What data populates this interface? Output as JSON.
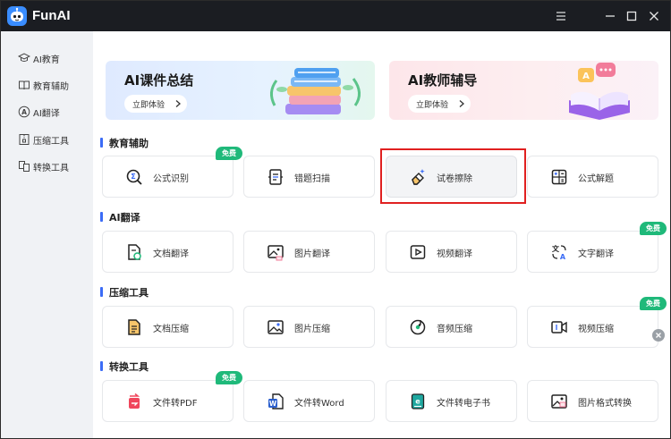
{
  "app": {
    "title": "FunAI"
  },
  "sidebar": {
    "items": [
      {
        "label": "AI教育",
        "icon": "graduation-cap-icon"
      },
      {
        "label": "教育辅助",
        "icon": "open-book-icon"
      },
      {
        "label": "AI翻译",
        "icon": "translate-icon"
      },
      {
        "label": "压缩工具",
        "icon": "archive-icon"
      },
      {
        "label": "转换工具",
        "icon": "convert-icon"
      }
    ]
  },
  "banners": [
    {
      "title": "AI课件总结",
      "button": "立即体验"
    },
    {
      "title": "AI教师辅导",
      "button": "立即体验"
    }
  ],
  "badge_text": "免费",
  "sections": [
    {
      "title": "教育辅助",
      "cards": [
        {
          "label": "公式识别",
          "icon": "formula-search-icon",
          "free": true
        },
        {
          "label": "错题扫描",
          "icon": "scan-document-icon",
          "free": false
        },
        {
          "label": "试卷擦除",
          "icon": "eraser-icon",
          "free": false
        },
        {
          "label": "公式解题",
          "icon": "calculator-icon",
          "free": false
        }
      ]
    },
    {
      "title": "AI翻译",
      "cards": [
        {
          "label": "文档翻译",
          "icon": "document-translate-icon",
          "free": false
        },
        {
          "label": "图片翻译",
          "icon": "image-translate-icon",
          "free": false
        },
        {
          "label": "视频翻译",
          "icon": "video-translate-icon",
          "free": false
        },
        {
          "label": "文字翻译",
          "icon": "text-translate-icon",
          "free": true
        }
      ]
    },
    {
      "title": "压缩工具",
      "cards": [
        {
          "label": "文档压缩",
          "icon": "document-compress-icon",
          "free": false
        },
        {
          "label": "图片压缩",
          "icon": "image-compress-icon",
          "free": false
        },
        {
          "label": "音频压缩",
          "icon": "audio-compress-icon",
          "free": false
        },
        {
          "label": "视频压缩",
          "icon": "video-compress-icon",
          "free": true
        }
      ]
    },
    {
      "title": "转换工具",
      "cards": [
        {
          "label": "文件转PDF",
          "icon": "pdf-convert-icon",
          "free": true
        },
        {
          "label": "文件转Word",
          "icon": "word-convert-icon",
          "free": false
        },
        {
          "label": "文件转电子书",
          "icon": "ebook-convert-icon",
          "free": false
        },
        {
          "label": "图片格式转换",
          "icon": "image-format-icon",
          "free": false
        }
      ]
    }
  ],
  "colors": {
    "titlebar": "#1b1d22",
    "accent": "#3b6cf6",
    "badge": "#1fb97a",
    "sidebar": "#f0f2f5",
    "highlight_frame": "#e02020"
  }
}
